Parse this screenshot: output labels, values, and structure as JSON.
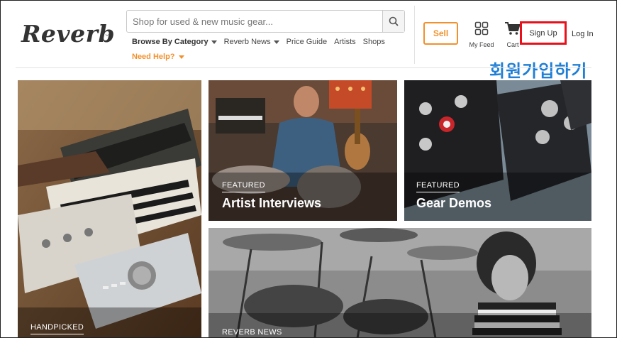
{
  "header": {
    "logo_text": "Reverb",
    "search_placeholder": "Shop for used & new music gear...",
    "nav": {
      "browse_by_category": "Browse By Category",
      "reverb_news": "Reverb News",
      "price_guide": "Price Guide",
      "artists": "Artists",
      "shops": "Shops"
    },
    "need_help": "Need Help?",
    "sell_label": "Sell",
    "my_feed_label": "My Feed",
    "cart_label": "Cart",
    "sign_up_label": "Sign Up",
    "log_in_label": "Log In"
  },
  "annotation": {
    "text": "회원가입하기"
  },
  "tiles": [
    {
      "id": "handpicked",
      "tag": "HANDPICKED",
      "title": ""
    },
    {
      "id": "artist-interviews",
      "tag": "FEATURED",
      "title": "Artist Interviews"
    },
    {
      "id": "gear-demos",
      "tag": "FEATURED",
      "title": "Gear Demos"
    },
    {
      "id": "reverb-news",
      "tag": "REVERB NEWS",
      "title": ""
    }
  ],
  "colors": {
    "brand_orange": "#f2912c",
    "highlight_red": "#e8101a",
    "annotation_blue": "#1f7fd6"
  },
  "icons": [
    "search-icon",
    "chevron-down-icon",
    "grid-feed-icon",
    "cart-icon"
  ]
}
